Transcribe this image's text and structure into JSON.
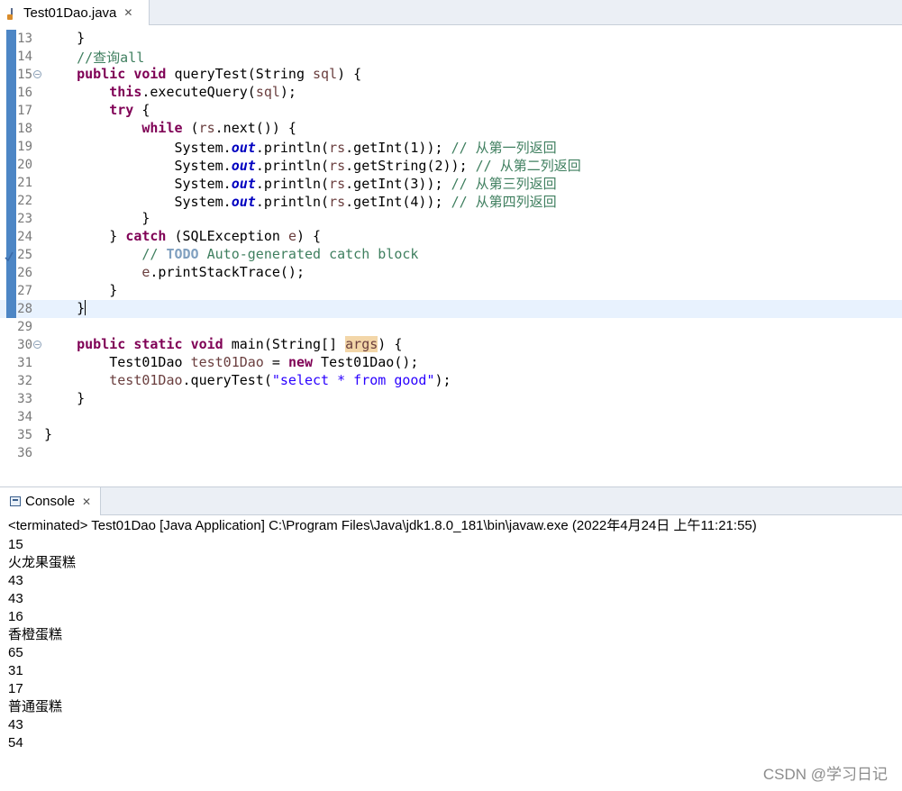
{
  "editor_tab": {
    "label": "Test01Dao.java",
    "close": "✕"
  },
  "code_lines": [
    {
      "num": "13",
      "fold": false,
      "marker": true,
      "current": false,
      "segs": [
        {
          "t": "    }",
          "c": ""
        }
      ]
    },
    {
      "num": "14",
      "fold": false,
      "marker": true,
      "current": false,
      "segs": [
        {
          "t": "    ",
          "c": ""
        },
        {
          "t": "//查询all",
          "c": "cm"
        }
      ]
    },
    {
      "num": "15",
      "fold": true,
      "marker": true,
      "current": false,
      "segs": [
        {
          "t": "    ",
          "c": ""
        },
        {
          "t": "public",
          "c": "kw"
        },
        {
          "t": " ",
          "c": ""
        },
        {
          "t": "void",
          "c": "kw"
        },
        {
          "t": " queryTest(String ",
          "c": ""
        },
        {
          "t": "sql",
          "c": "var"
        },
        {
          "t": ") {",
          "c": ""
        }
      ]
    },
    {
      "num": "16",
      "fold": false,
      "marker": true,
      "current": false,
      "segs": [
        {
          "t": "        ",
          "c": ""
        },
        {
          "t": "this",
          "c": "kw"
        },
        {
          "t": ".executeQuery(",
          "c": ""
        },
        {
          "t": "sql",
          "c": "var"
        },
        {
          "t": ");",
          "c": ""
        }
      ]
    },
    {
      "num": "17",
      "fold": false,
      "marker": true,
      "current": false,
      "segs": [
        {
          "t": "        ",
          "c": ""
        },
        {
          "t": "try",
          "c": "kw"
        },
        {
          "t": " {",
          "c": ""
        }
      ]
    },
    {
      "num": "18",
      "fold": false,
      "marker": true,
      "current": false,
      "segs": [
        {
          "t": "            ",
          "c": ""
        },
        {
          "t": "while",
          "c": "kw"
        },
        {
          "t": " (",
          "c": ""
        },
        {
          "t": "rs",
          "c": "var"
        },
        {
          "t": ".next()) {",
          "c": ""
        }
      ]
    },
    {
      "num": "19",
      "fold": false,
      "marker": true,
      "current": false,
      "segs": [
        {
          "t": "                System.",
          "c": ""
        },
        {
          "t": "out",
          "c": "fld"
        },
        {
          "t": ".println(",
          "c": ""
        },
        {
          "t": "rs",
          "c": "var"
        },
        {
          "t": ".getInt(1)); ",
          "c": ""
        },
        {
          "t": "// 从第一列返回",
          "c": "cm"
        }
      ]
    },
    {
      "num": "20",
      "fold": false,
      "marker": true,
      "current": false,
      "segs": [
        {
          "t": "                System.",
          "c": ""
        },
        {
          "t": "out",
          "c": "fld"
        },
        {
          "t": ".println(",
          "c": ""
        },
        {
          "t": "rs",
          "c": "var"
        },
        {
          "t": ".getString(2)); ",
          "c": ""
        },
        {
          "t": "// 从第二列返回",
          "c": "cm"
        }
      ]
    },
    {
      "num": "21",
      "fold": false,
      "marker": true,
      "current": false,
      "segs": [
        {
          "t": "                System.",
          "c": ""
        },
        {
          "t": "out",
          "c": "fld"
        },
        {
          "t": ".println(",
          "c": ""
        },
        {
          "t": "rs",
          "c": "var"
        },
        {
          "t": ".getInt(3)); ",
          "c": ""
        },
        {
          "t": "// 从第三列返回",
          "c": "cm"
        }
      ]
    },
    {
      "num": "22",
      "fold": false,
      "marker": true,
      "current": false,
      "segs": [
        {
          "t": "                System.",
          "c": ""
        },
        {
          "t": "out",
          "c": "fld"
        },
        {
          "t": ".println(",
          "c": ""
        },
        {
          "t": "rs",
          "c": "var"
        },
        {
          "t": ".getInt(4)); ",
          "c": ""
        },
        {
          "t": "// 从第四列返回",
          "c": "cm"
        }
      ]
    },
    {
      "num": "23",
      "fold": false,
      "marker": true,
      "current": false,
      "segs": [
        {
          "t": "            }",
          "c": ""
        }
      ]
    },
    {
      "num": "24",
      "fold": false,
      "marker": true,
      "current": false,
      "segs": [
        {
          "t": "        } ",
          "c": ""
        },
        {
          "t": "catch",
          "c": "kw"
        },
        {
          "t": " (SQLException ",
          "c": ""
        },
        {
          "t": "e",
          "c": "var"
        },
        {
          "t": ") {",
          "c": ""
        }
      ]
    },
    {
      "num": "25",
      "fold": false,
      "marker": true,
      "current": false,
      "task": true,
      "segs": [
        {
          "t": "            ",
          "c": ""
        },
        {
          "t": "// ",
          "c": "cm"
        },
        {
          "t": "TODO",
          "c": "todo"
        },
        {
          "t": " Auto-generated catch block",
          "c": "cm"
        }
      ]
    },
    {
      "num": "26",
      "fold": false,
      "marker": true,
      "current": false,
      "segs": [
        {
          "t": "            ",
          "c": ""
        },
        {
          "t": "e",
          "c": "var"
        },
        {
          "t": ".printStackTrace();",
          "c": ""
        }
      ]
    },
    {
      "num": "27",
      "fold": false,
      "marker": true,
      "current": false,
      "segs": [
        {
          "t": "        }",
          "c": ""
        }
      ]
    },
    {
      "num": "28",
      "fold": false,
      "marker": true,
      "current": true,
      "caret": true,
      "segs": [
        {
          "t": "    }",
          "c": ""
        }
      ]
    },
    {
      "num": "29",
      "fold": false,
      "marker": false,
      "current": false,
      "segs": []
    },
    {
      "num": "30",
      "fold": true,
      "marker": false,
      "current": false,
      "segs": [
        {
          "t": "    ",
          "c": ""
        },
        {
          "t": "public",
          "c": "kw"
        },
        {
          "t": " ",
          "c": ""
        },
        {
          "t": "static",
          "c": "kw"
        },
        {
          "t": " ",
          "c": ""
        },
        {
          "t": "void",
          "c": "kw"
        },
        {
          "t": " main(String[] ",
          "c": ""
        },
        {
          "t": "args",
          "c": "var hl"
        },
        {
          "t": ") {",
          "c": ""
        }
      ]
    },
    {
      "num": "31",
      "fold": false,
      "marker": false,
      "current": false,
      "segs": [
        {
          "t": "        Test01Dao ",
          "c": ""
        },
        {
          "t": "test01Dao",
          "c": "var"
        },
        {
          "t": " = ",
          "c": ""
        },
        {
          "t": "new",
          "c": "kw"
        },
        {
          "t": " Test01Dao();",
          "c": ""
        }
      ]
    },
    {
      "num": "32",
      "fold": false,
      "marker": false,
      "current": false,
      "segs": [
        {
          "t": "        ",
          "c": ""
        },
        {
          "t": "test01Dao",
          "c": "var"
        },
        {
          "t": ".queryTest(",
          "c": ""
        },
        {
          "t": "\"select * from good\"",
          "c": "str"
        },
        {
          "t": ");",
          "c": ""
        }
      ]
    },
    {
      "num": "33",
      "fold": false,
      "marker": false,
      "current": false,
      "segs": [
        {
          "t": "    }",
          "c": ""
        }
      ]
    },
    {
      "num": "34",
      "fold": false,
      "marker": false,
      "current": false,
      "segs": []
    },
    {
      "num": "35",
      "fold": false,
      "marker": false,
      "current": false,
      "segs": [
        {
          "t": "}",
          "c": ""
        }
      ]
    },
    {
      "num": "36",
      "fold": false,
      "marker": false,
      "current": false,
      "segs": []
    }
  ],
  "hscroll_arrow": "<",
  "console_tab": {
    "label": "Console",
    "close": "✕"
  },
  "console": {
    "status": "<terminated> Test01Dao [Java Application] C:\\Program Files\\Java\\jdk1.8.0_181\\bin\\javaw.exe (2022年4月24日 上午11:21:55)",
    "output": [
      "15",
      "火龙果蛋糕",
      "43",
      "43",
      "16",
      "香橙蛋糕",
      "65",
      "31",
      "17",
      "普通蛋糕",
      "43",
      "54"
    ]
  },
  "watermark": "CSDN @学习日记"
}
